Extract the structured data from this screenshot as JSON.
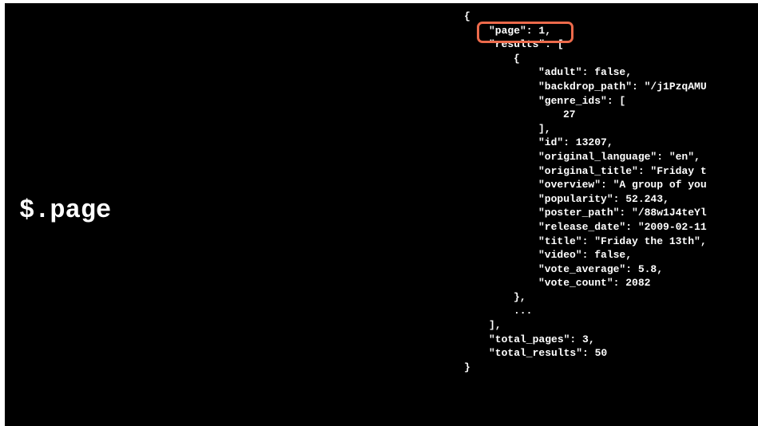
{
  "expression": "$.page",
  "highlight_color": "#ec6a4b",
  "json_lines": [
    {
      "indent": 0,
      "text": "{"
    },
    {
      "indent": 1,
      "text": "\"page\": 1,"
    },
    {
      "indent": 1,
      "text": "\"results\": ["
    },
    {
      "indent": 2,
      "text": "{"
    },
    {
      "indent": 3,
      "text": "\"adult\": false,"
    },
    {
      "indent": 3,
      "text": "\"backdrop_path\": \"/j1PzqAMU"
    },
    {
      "indent": 3,
      "text": "\"genre_ids\": ["
    },
    {
      "indent": 4,
      "text": "27"
    },
    {
      "indent": 3,
      "text": "],"
    },
    {
      "indent": 3,
      "text": "\"id\": 13207,"
    },
    {
      "indent": 3,
      "text": "\"original_language\": \"en\","
    },
    {
      "indent": 3,
      "text": "\"original_title\": \"Friday t"
    },
    {
      "indent": 3,
      "text": "\"overview\": \"A group of you"
    },
    {
      "indent": 3,
      "text": "\"popularity\": 52.243,"
    },
    {
      "indent": 3,
      "text": "\"poster_path\": \"/88w1J4teYl"
    },
    {
      "indent": 3,
      "text": "\"release_date\": \"2009-02-11"
    },
    {
      "indent": 3,
      "text": "\"title\": \"Friday the 13th\","
    },
    {
      "indent": 3,
      "text": "\"video\": false,"
    },
    {
      "indent": 3,
      "text": "\"vote_average\": 5.8,"
    },
    {
      "indent": 3,
      "text": "\"vote_count\": 2082"
    },
    {
      "indent": 2,
      "text": "},"
    },
    {
      "indent": 2,
      "text": "..."
    },
    {
      "indent": 1,
      "text": "],"
    },
    {
      "indent": 1,
      "text": "\"total_pages\": 3,"
    },
    {
      "indent": 1,
      "text": "\"total_results\": 50"
    },
    {
      "indent": 0,
      "text": "}"
    }
  ]
}
